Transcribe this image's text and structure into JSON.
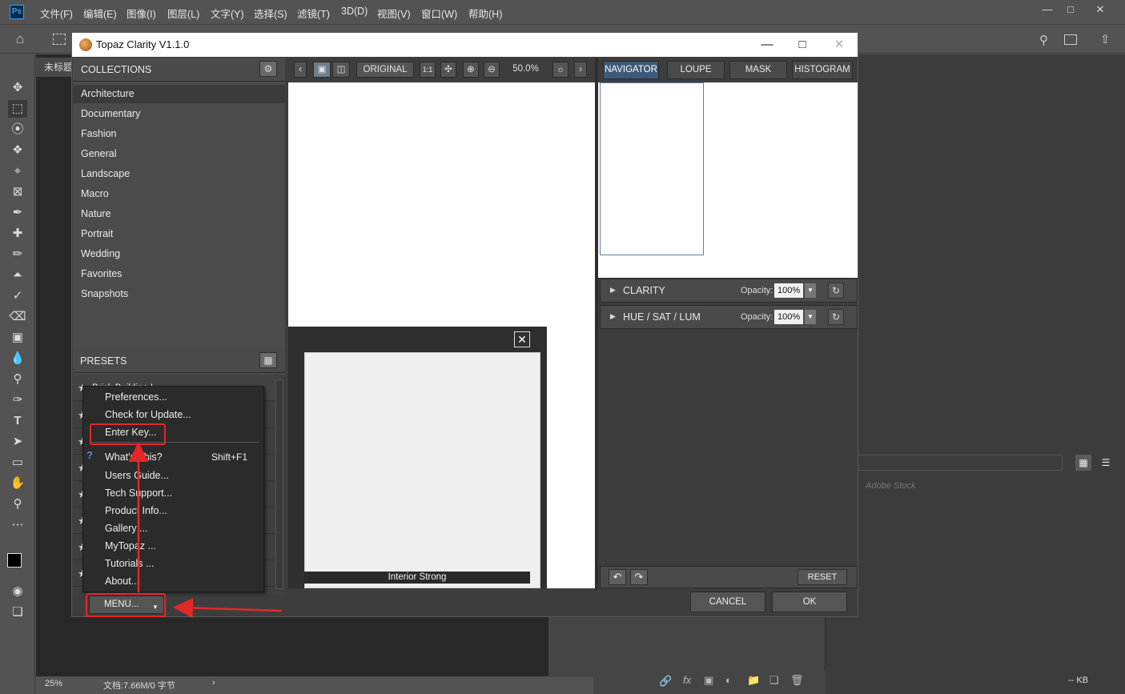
{
  "ps": {
    "logo": "Ps",
    "menu": [
      "文件(F)",
      "编辑(E)",
      "图像(I)",
      "图层(L)",
      "文字(Y)",
      "选择(S)",
      "滤镜(T)",
      "3D(D)",
      "视图(V)",
      "窗口(W)",
      "帮助(H)"
    ],
    "doc_tab": "未标题",
    "status_zoom": "25%",
    "status_doc": "文档:7.66M/0 字节",
    "status_arrow": "›",
    "right_panel_search": "Adobe Stock",
    "right_bottom_kb": "-- KB"
  },
  "topaz": {
    "title": "Topaz Clarity V1.1.0",
    "collections_header": "COLLECTIONS",
    "collections": [
      "Architecture",
      "Documentary",
      "Fashion",
      "General",
      "Landscape",
      "Macro",
      "Nature",
      "Portrait",
      "Wedding",
      "Favorites",
      "Snapshots"
    ],
    "presets_header": "PRESETS",
    "presets": [
      "Brick Building I"
    ],
    "viewbar": {
      "original": "ORIGINAL",
      "one_to_one": "1:1",
      "zoom": "50.0%"
    },
    "popup": {
      "caption": "Interior Strong",
      "close": "✕"
    },
    "tabs": [
      "NAVIGATOR",
      "LOUPE",
      "MASK",
      "HISTOGRAM"
    ],
    "adjustments": [
      {
        "label": "CLARITY",
        "opacity_label": "Opacity:",
        "opacity": "100%"
      },
      {
        "label": "HUE / SAT / LUM",
        "opacity_label": "Opacity:",
        "opacity": "100%"
      }
    ],
    "reset": "RESET",
    "cancel": "CANCEL",
    "ok": "OK",
    "menu_button": "MENU..."
  },
  "context_menu": {
    "items_top": [
      "Preferences...",
      "Check for Update...",
      "Enter Key..."
    ],
    "items_bottom": [
      "What's This?",
      "Users Guide...",
      "Tech Support...",
      "Product Info...",
      "Gallery ...",
      "MyTopaz ...",
      "Tutorials ...",
      "About..."
    ],
    "whats_this_shortcut": "Shift+F1"
  },
  "annotation_color": "#e4282a"
}
